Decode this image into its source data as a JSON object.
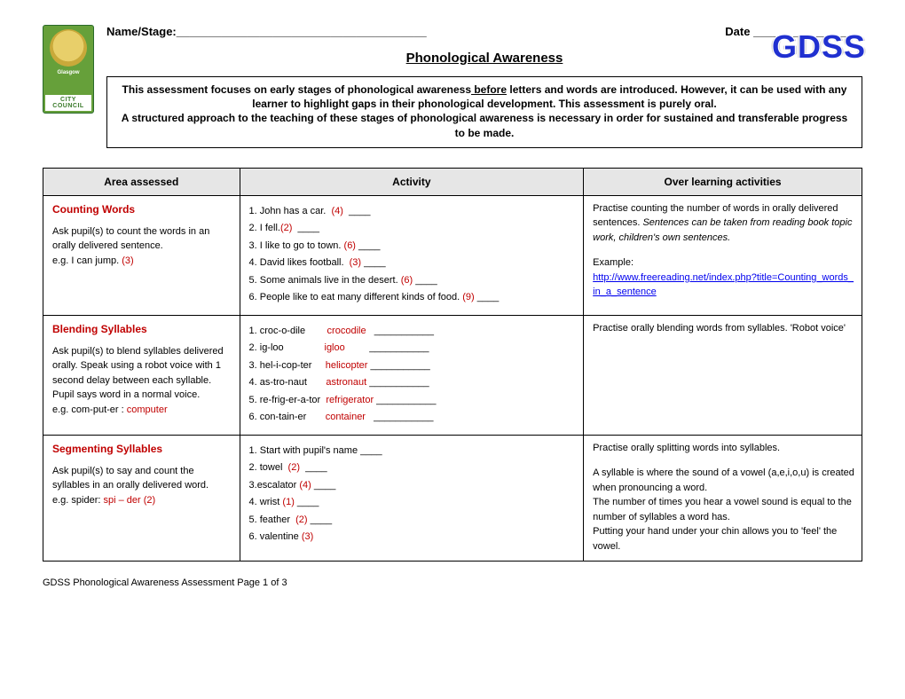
{
  "header": {
    "name_label": "Name/Stage:_______________________________________",
    "date_label": "Date _________________",
    "title": "Phonological Awareness",
    "logo_brand": "Glasgow",
    "logo_sub": "CITY COUNCIL",
    "badge": "GDSS"
  },
  "intro": {
    "p1a": "This assessment focuses on early stages of phonological awareness",
    "p1b": " before",
    "p1c": " letters and words are introduced. However, it can be used with any learner to highlight gaps in their phonological development.  This assessment is purely oral.",
    "p2": "A structured approach to the teaching of these stages of phonological awareness is necessary in order for sustained and transferable progress to be made."
  },
  "cols": {
    "c1": "Area assessed",
    "c2": "Activity",
    "c3": "Over learning activities"
  },
  "rows": [
    {
      "area_title": "Counting Words",
      "area_desc": "Ask pupil(s) to count the words in an orally delivered sentence.",
      "area_eg_pre": "e.g. I can jump. ",
      "area_eg_red": "(3)",
      "activity": [
        {
          "pre": "1. John has a car.  ",
          "red": "(4)",
          "post": "  ____"
        },
        {
          "pre": "2. I fell.",
          "red": "(2)",
          "post": "  ____"
        },
        {
          "pre": "3. I like to go to town. ",
          "red": "(6)",
          "post": " ____"
        },
        {
          "pre": "4. David likes football.  ",
          "red": "(3)",
          "post": " ____"
        },
        {
          "pre": "5. Some animals live in the desert. ",
          "red": "(6)",
          "post": " ____"
        },
        {
          "pre": "6. People like to eat many different kinds of food. ",
          "red": "(9)",
          "post": " ____"
        }
      ],
      "over_pre": "Practise counting the number of words in orally delivered sentences.  ",
      "over_em": "Sentences can be taken from reading book topic work, children's own sentences.",
      "over_example_label": "Example:",
      "over_link_text": "http://www.freereading.net/index.php?title=Counting_words_in_a_sentence"
    },
    {
      "area_title": "Blending Syllables",
      "area_desc": "Ask pupil(s) to blend syllables delivered orally.  Speak using a robot voice with 1 second delay between each syllable.  Pupil says word in a normal voice.",
      "area_eg_pre": "e.g. com-put-er :   ",
      "area_eg_red": "computer",
      "activity": [
        {
          "pre": "1. croc-o-dile        ",
          "red": "crocodile",
          "post": "   ___________"
        },
        {
          "pre": "2. ig-loo               ",
          "red": "igloo",
          "post": "         ___________"
        },
        {
          "pre": "3. hel-i-cop-ter     ",
          "red": "helicopter",
          "post": " ___________"
        },
        {
          "pre": "4. as-tro-naut       ",
          "red": "astronaut",
          "post": " ___________"
        },
        {
          "pre": "5. re-frig-er-a-tor  ",
          "red": "refrigerator",
          "post": " ___________"
        },
        {
          "pre": "6. con-tain-er       ",
          "red": "container",
          "post": "   ___________"
        }
      ],
      "over_pre": "Practise orally blending words from syllables. 'Robot voice'",
      "over_em": "",
      "over_example_label": "",
      "over_link_text": ""
    },
    {
      "area_title": "Segmenting Syllables",
      "area_desc": "Ask pupil(s) to say and count the syllables in an orally delivered word.",
      "area_eg_pre": "e.g. spider:   ",
      "area_eg_red": "spi – der (2)",
      "activity": [
        {
          "pre": "1. Start with pupil's name ____",
          "red": "",
          "post": ""
        },
        {
          "pre": "2. towel  ",
          "red": "(2)",
          "post": "  ____"
        },
        {
          "pre": "3.escalator ",
          "red": "(4)",
          "post": " ____"
        },
        {
          "pre": "4. wrist ",
          "red": "(1)",
          "post": " ____"
        },
        {
          "pre": "5. feather  ",
          "red": "(2)",
          "post": " ____"
        },
        {
          "pre": "6. valentine ",
          "red": "(3)",
          "post": ""
        }
      ],
      "over_pre": "Practise orally splitting words into syllables.",
      "over_em": "",
      "over_extra": "A syllable is where the sound of a vowel (a,e,i,o,u) is created when pronouncing a word.\nThe number of times you hear a vowel sound is equal to the number of syllables a word has.\nPutting your hand under your chin allows you to 'feel' the vowel.",
      "over_example_label": "",
      "over_link_text": ""
    }
  ],
  "footer": "GDSS Phonological Awareness Assessment Page 1 of 3"
}
